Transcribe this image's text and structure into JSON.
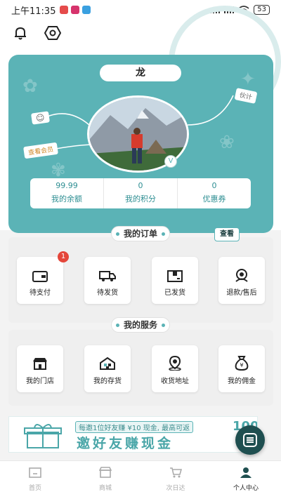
{
  "status_bar": {
    "time": "上午11:35",
    "network_speed": "",
    "battery": "53"
  },
  "profile": {
    "name": "龙",
    "smile_tag": "☺",
    "view_member_tag": "查看会员",
    "partner_tag": "伙计",
    "verified_badge": "V",
    "stats": [
      {
        "value": "99.99",
        "label": "我的余额"
      },
      {
        "value": "0",
        "label": "我的积分"
      },
      {
        "value": "0",
        "label": "优惠券"
      }
    ]
  },
  "orders": {
    "title": "我的订单",
    "view_label": "查看",
    "items": [
      {
        "label": "待支付",
        "icon": "wallet-icon",
        "badge": "1"
      },
      {
        "label": "待发货",
        "icon": "truck-icon"
      },
      {
        "label": "已发货",
        "icon": "package-icon"
      },
      {
        "label": "退款/售后",
        "icon": "support-icon"
      }
    ]
  },
  "services": {
    "title": "我的服务",
    "items": [
      {
        "label": "我的门店",
        "icon": "store-icon"
      },
      {
        "label": "我的存货",
        "icon": "warehouse-icon"
      },
      {
        "label": "收货地址",
        "icon": "location-icon"
      },
      {
        "label": "我的佣金",
        "icon": "money-bag-icon"
      }
    ]
  },
  "banner": {
    "subtitle": "每邀1位好友赚 ¥10 现金, 最高可返",
    "title": "邀好友赚现金",
    "amount": "100"
  },
  "tabbar": [
    {
      "label": "首页",
      "icon": "home-icon",
      "active": false
    },
    {
      "label": "商城",
      "icon": "shop-icon",
      "active": false
    },
    {
      "label": "次日达",
      "icon": "cart-icon",
      "active": false
    },
    {
      "label": "个人中心",
      "icon": "person-icon",
      "active": true
    }
  ],
  "colors": {
    "accent": "#5bb3b6",
    "badge": "#e4463a"
  }
}
